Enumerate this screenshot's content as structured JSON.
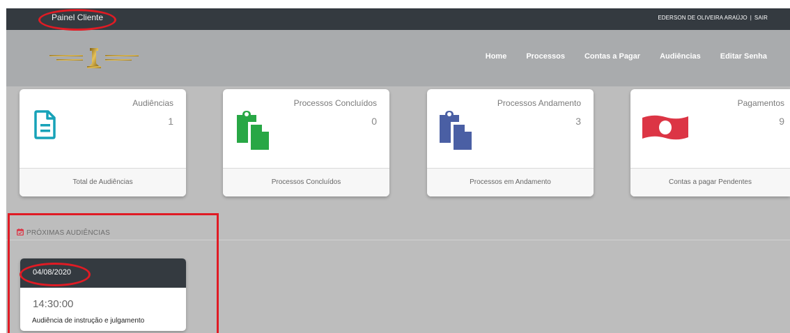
{
  "topbar": {
    "brand": "Painel Cliente",
    "user_name": "EDERSON DE OLIVEIRA ARAÚJO",
    "separator": "|",
    "logout": "SAIR"
  },
  "nav": {
    "items": [
      {
        "label": "Home"
      },
      {
        "label": "Processos"
      },
      {
        "label": "Contas a Pagar"
      },
      {
        "label": "Audiências"
      },
      {
        "label": "Editar Senha"
      }
    ]
  },
  "cards": [
    {
      "title": "Audiências",
      "value": "1",
      "footer": "Total de Audiências",
      "icon": "document-icon",
      "color": "#17a2b8"
    },
    {
      "title": "Processos Concluídos",
      "value": "0",
      "footer": "Processos Concluídos",
      "icon": "clipboard-copy-icon",
      "color": "#28a745"
    },
    {
      "title": "Processos Andamento",
      "value": "3",
      "footer": "Processos em Andamento",
      "icon": "clipboard-copy-icon",
      "color": "#4a5fa4"
    },
    {
      "title": "Pagamentos",
      "value": "9",
      "footer": "Contas a pagar Pendentes",
      "icon": "money-bill-icon",
      "color": "#dc3545"
    }
  ],
  "section": {
    "title": "PRÓXIMAS AUDIÊNCIAS",
    "icon": "calendar-check-icon",
    "color": "#dc3545"
  },
  "hearing": {
    "date": "04/08/2020",
    "time": "14:30:00",
    "description": "Audiência de instrução e julgamento"
  },
  "annotation_color": "#e01b24"
}
